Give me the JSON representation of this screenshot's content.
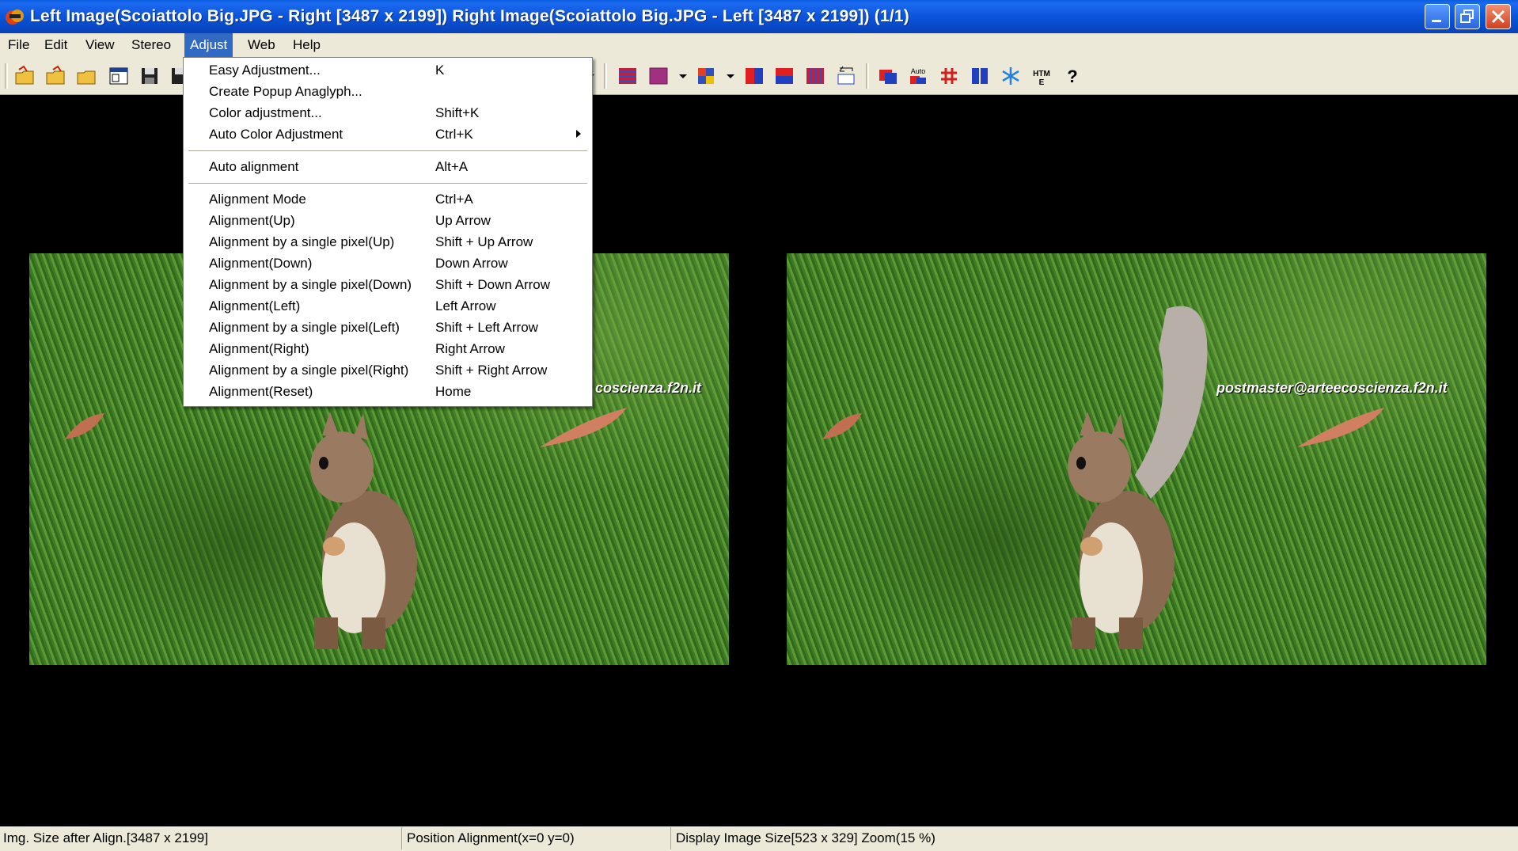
{
  "window": {
    "title": "Left Image(Scoiattolo Big.JPG - Right [3487 x 2199]) Right Image(Scoiattolo Big.JPG - Left [3487 x 2199])  (1/1)"
  },
  "menubar": {
    "items": [
      "File",
      "Edit",
      "View",
      "Stereo",
      "Adjust",
      "Web",
      "Help"
    ],
    "active": "Adjust"
  },
  "toolbar": {
    "auto_label": "Auto",
    "htm_label": "HTM",
    "help_label": "?"
  },
  "adjust_menu": {
    "items": [
      {
        "label": "Easy Adjustment...",
        "shortcut": "K"
      },
      {
        "label": "Create Popup Anaglyph...",
        "shortcut": ""
      },
      {
        "label": "Color adjustment...",
        "shortcut": "Shift+K"
      },
      {
        "label": "Auto Color Adjustment",
        "shortcut": "Ctrl+K"
      },
      {
        "label": "Auto alignment",
        "shortcut": "Alt+A"
      },
      {
        "label": "Alignment Mode",
        "shortcut": "Ctrl+A"
      },
      {
        "label": "Alignment(Up)",
        "shortcut": "Up Arrow"
      },
      {
        "label": "Alignment by a single pixel(Up)",
        "shortcut": "Shift + Up Arrow"
      },
      {
        "label": "Alignment(Down)",
        "shortcut": "Down Arrow"
      },
      {
        "label": "Alignment by a single pixel(Down)",
        "shortcut": "Shift + Down Arrow"
      },
      {
        "label": "Alignment(Left)",
        "shortcut": "Left Arrow"
      },
      {
        "label": "Alignment by a single pixel(Left)",
        "shortcut": "Shift + Left Arrow"
      },
      {
        "label": "Alignment(Right)",
        "shortcut": "Right Arrow"
      },
      {
        "label": "Alignment by a single pixel(Right)",
        "shortcut": "Shift + Right Arrow"
      },
      {
        "label": "Alignment(Reset)",
        "shortcut": "Home"
      }
    ]
  },
  "images": {
    "left_watermark": "coscienza.f2n.it",
    "right_watermark": "postmaster@arteecoscienza.f2n.it"
  },
  "statusbar": {
    "size_after_align": "Img. Size after Align.[3487 x 2199]",
    "position_alignment": "Position Alignment(x=0 y=0)",
    "display_info": "Display Image Size[523 x 329]  Zoom(15 %)"
  }
}
